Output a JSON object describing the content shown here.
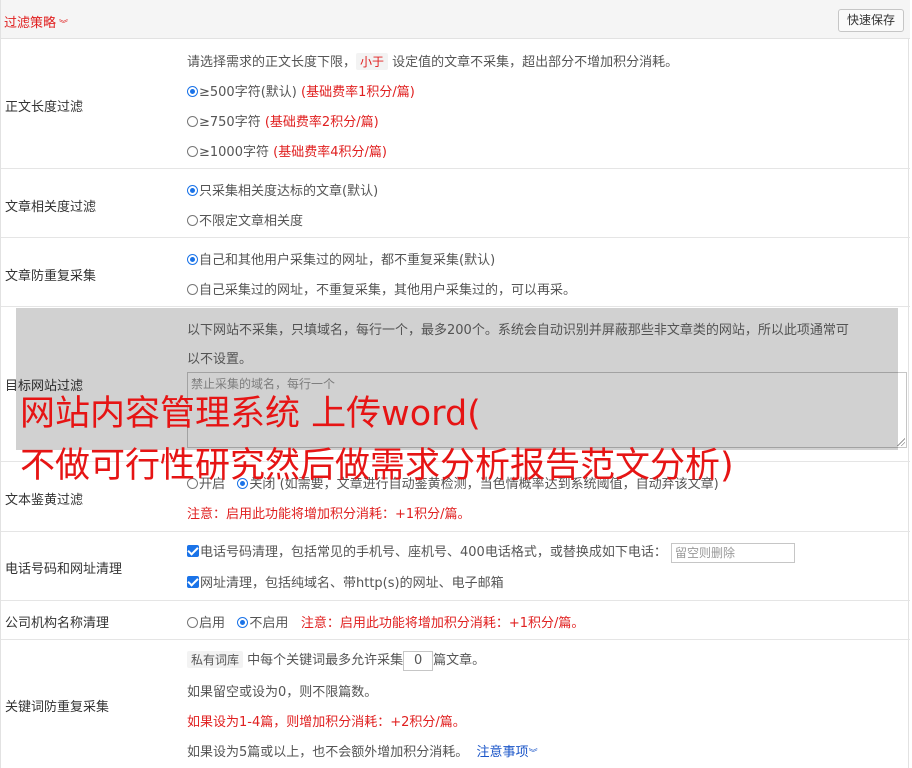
{
  "header": {
    "title": "过滤策略",
    "chevron_icon": "chevron-down-icon",
    "save_button": "快速保存"
  },
  "length_filter": {
    "label": "正文长度过滤",
    "desc_pre": "请选择需求的正文长度下限，",
    "desc_tag": "小于",
    "desc_post": " 设定值的文章不采集，超出部分不增加积分消耗。",
    "options": [
      {
        "text": "≥500字符(默认)",
        "note": "(基础费率1积分/篇)",
        "selected": true
      },
      {
        "text": "≥750字符",
        "note": "(基础费率2积分/篇)",
        "selected": false
      },
      {
        "text": "≥1000字符",
        "note": "(基础费率4积分/篇)",
        "selected": false
      }
    ]
  },
  "relevance_filter": {
    "label": "文章相关度过滤",
    "options": [
      {
        "text": "只采集相关度达标的文章(默认)",
        "selected": true
      },
      {
        "text": "不限定文章相关度",
        "selected": false
      }
    ]
  },
  "dedupe": {
    "label": "文章防重复采集",
    "options": [
      {
        "text": "自己和其他用户采集过的网址，都不重复采集(默认)",
        "selected": true
      },
      {
        "text": "自己采集过的网址，不重复采集，其他用户采集过的，可以再采。",
        "selected": false
      }
    ]
  },
  "site_filter": {
    "label": "目标网站过滤",
    "desc_line1": "以下网站不采集，只填域名，每行一个，最多200个。系统会自动识别并屏蔽那些非文章类的网站，所以此项通常可",
    "desc_line2": "以不设置。",
    "placeholder": "禁止采集的域名，每行一个"
  },
  "porn_filter": {
    "label": "文本鉴黄过滤",
    "opt_on": "开启",
    "opt_off": "关闭",
    "hidden_desc": "(如需要，文章进行自动鉴黄检测，当色情概率达到系统阈值，自动弃该文章)",
    "note": "注意：启用此功能将增加积分消耗：+1积分/篇。"
  },
  "phone_url": {
    "label": "电话号码和网址清理",
    "phone_text": "电话号码清理，包括常见的手机号、座机号、400电话格式，或替换成如下电话：",
    "phone_placeholder": "留空则删除",
    "url_text": "网址清理，包括纯域名、带http(s)的网址、电子邮箱"
  },
  "company": {
    "label": "公司机构名称清理",
    "opt_on": "启用",
    "opt_off": "不启用",
    "note": "注意：启用此功能将增加积分消耗：+1积分/篇。"
  },
  "keyword": {
    "label": "关键词防重复采集",
    "tag": "私有词库",
    "text_pre": " 中每个关键词最多允许采集",
    "count": "0",
    "text_post": "篇文章。",
    "line2": "如果留空或设为0，则不限篇数。",
    "line3": "如果设为1-4篇，则增加积分消耗：+2积分/篇。",
    "line4": "如果设为5篇或以上，也不会额外增加积分消耗。",
    "link": "注意事项",
    "link_chevron": "chevron-down-icon"
  },
  "watermark": {
    "line1": "网站内容管理系统 上传word(",
    "line2": "不做可行性研究然后做需求分析报告范文分析)"
  },
  "colors": {
    "accent": "#e02020",
    "link": "#1a55c8",
    "checkbox": "#1a73e8"
  }
}
